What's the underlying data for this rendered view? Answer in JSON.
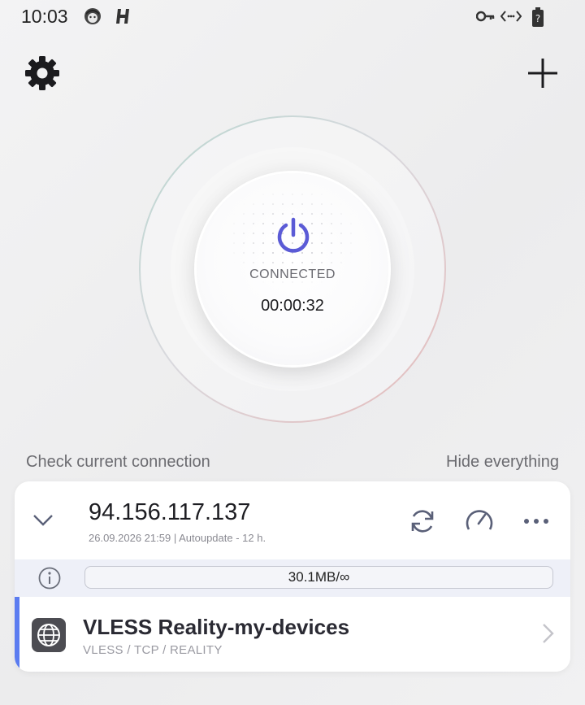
{
  "status_bar": {
    "time": "10:03",
    "left_icons": [
      "face-notification-icon",
      "app-h-icon"
    ],
    "right_icons": [
      "vpn-key-icon",
      "data-transfer-icon",
      "battery-unknown-icon"
    ]
  },
  "toolbar": {
    "settings_icon": "gear-icon",
    "add_icon": "plus-icon"
  },
  "connection": {
    "status": "CONNECTED",
    "timer": "00:00:32",
    "power_icon": "power-icon",
    "accent_color": "#5b5bd6"
  },
  "links": {
    "check_connection": "Check current connection",
    "hide_everything": "Hide everything"
  },
  "subscription": {
    "ip": "94.156.117.137",
    "meta": "26.09.2026 21:59 | Autoupdate - 12 h.",
    "traffic": "30.1MB/∞",
    "actions": [
      "refresh-icon",
      "speed-test-icon",
      "more-icon"
    ]
  },
  "server": {
    "name": "VLESS Reality-my-devices",
    "protocol": "VLESS / TCP / REALITY",
    "accent_color": "#5b7cf0"
  }
}
